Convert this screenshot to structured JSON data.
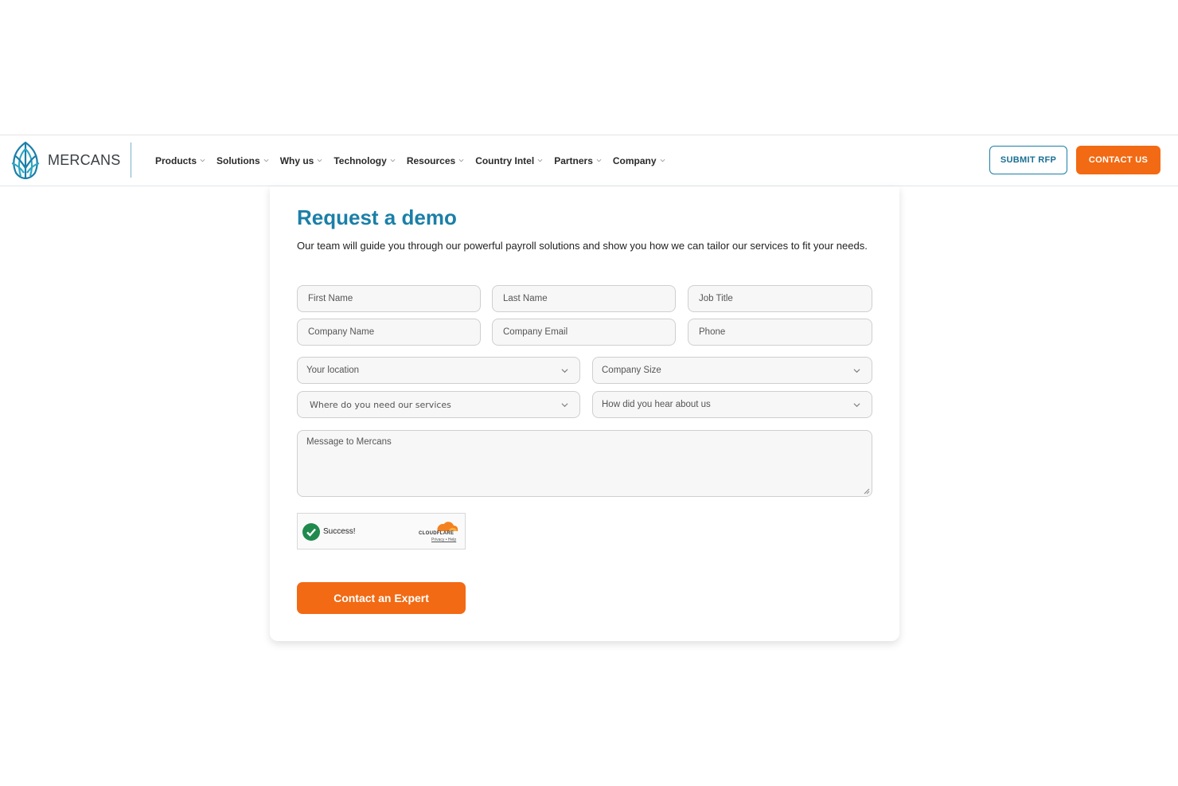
{
  "brand": {
    "name": "MERCANS",
    "accent": "#1b7fa8",
    "orange": "#f26a13"
  },
  "nav": {
    "items": [
      {
        "label": "Products"
      },
      {
        "label": "Solutions"
      },
      {
        "label": "Why us"
      },
      {
        "label": "Technology"
      },
      {
        "label": "Resources"
      },
      {
        "label": "Country Intel"
      },
      {
        "label": "Partners"
      },
      {
        "label": "Company"
      }
    ],
    "submit_rfp": "SUBMIT RFP",
    "contact_us": "CONTACT US"
  },
  "form": {
    "title": "Request a demo",
    "subtitle": "Our team will guide you through our powerful payroll solutions and show you how we can tailor our services to fit your needs.",
    "fields": {
      "first_name": "First Name",
      "last_name": "Last Name",
      "job_title": "Job Title",
      "company_name": "Company Name",
      "company_email": "Company Email",
      "phone": "Phone",
      "location": "Your location",
      "company_size": "Company Size",
      "services_location": "Where do you need our services",
      "referral": "How did you hear about us",
      "message": "Message to Mercans"
    },
    "captcha": {
      "status": "Success!",
      "provider": "CLOUDFLARE",
      "links": "Privacy • Help"
    },
    "submit": "Contact an Expert"
  }
}
